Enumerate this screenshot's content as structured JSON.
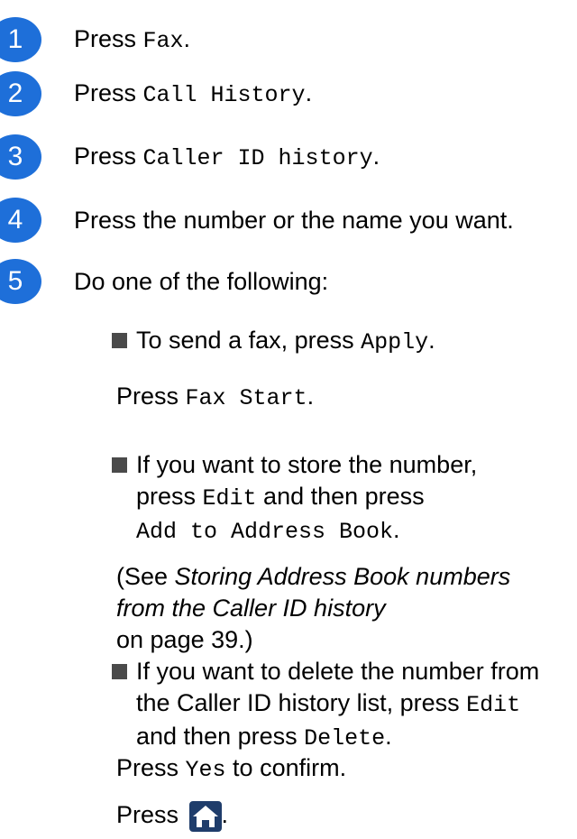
{
  "steps": [
    {
      "num": "1",
      "prefix": "Press ",
      "mono": "Fax",
      "suffix": "."
    },
    {
      "num": "2",
      "prefix": "Press ",
      "mono": "Call History",
      "suffix": "."
    },
    {
      "num": "3",
      "prefix": "Press ",
      "mono": "Caller ID history",
      "suffix": "."
    },
    {
      "num": "4",
      "text": "Press the number or the name you want."
    },
    {
      "num": "5",
      "text": "Do one of the following:"
    }
  ],
  "bullet1": {
    "prefix": "To send a fax, press ",
    "mono": "Apply",
    "suffix": ".",
    "line2_prefix": "Press ",
    "line2_mono": "Fax Start",
    "line2_suffix": "."
  },
  "bullet2": {
    "line1": "If you want to store the number,",
    "line2_prefix": "press ",
    "line2_mono": "Edit",
    "line2_suffix": " and then press",
    "line3_mono": "Add to Address Book",
    "line3_suffix": ".",
    "ref_open": "(See ",
    "ref_italic1": "Storing Address Book numbers",
    "ref_italic2": "from the Caller ID history",
    "ref_close": "on page 39.)"
  },
  "bullet3": {
    "line1": "If you want to delete the number from",
    "line2_prefix": "the Caller ID history list, press ",
    "line2_mono": "Edit",
    "line3_prefix": "and then press ",
    "line3_mono": "Delete",
    "line3_suffix": ".",
    "confirm_prefix": "Press ",
    "confirm_mono": "Yes",
    "confirm_suffix": " to confirm.",
    "home_prefix": "Press ",
    "home_suffix": "."
  },
  "icons": {
    "home": "home-icon"
  },
  "colors": {
    "step_circle": "#1e6fd9",
    "home_button": "#1f3d6b"
  }
}
